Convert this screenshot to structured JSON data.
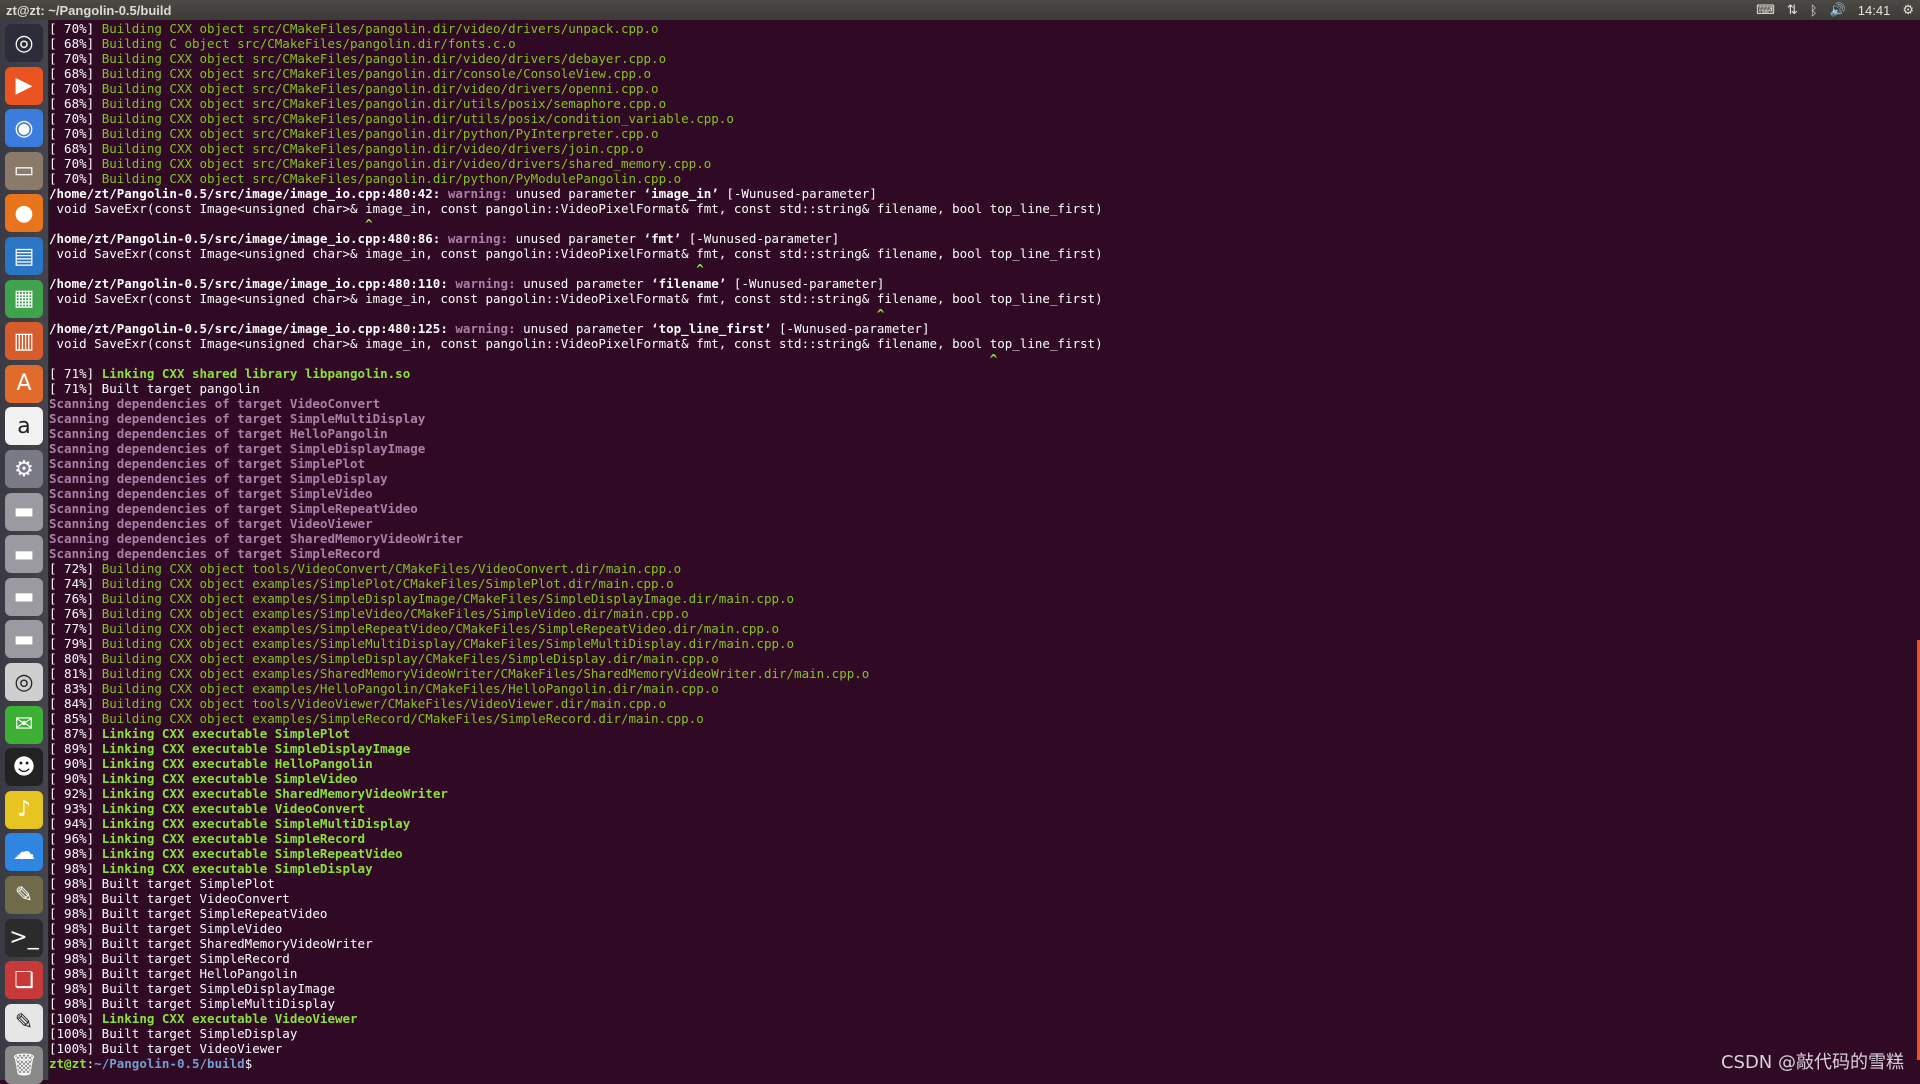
{
  "window": {
    "title": "zt@zt: ~/Pangolin-0.5/build"
  },
  "tray": {
    "time": "14:41"
  },
  "watermark": "CSDN @敲代码的雪糕",
  "launcher_colors": {
    "accent": "#e95420"
  },
  "build_lines_1": [
    [
      "[ 70%] ",
      "Building CXX object src/CMakeFiles/pangolin.dir/video/drivers/unpack.cpp.o"
    ],
    [
      "[ 68%] ",
      "Building C object src/CMakeFiles/pangolin.dir/fonts.c.o"
    ],
    [
      "[ 70%] ",
      "Building CXX object src/CMakeFiles/pangolin.dir/video/drivers/debayer.cpp.o"
    ],
    [
      "[ 68%] ",
      "Building CXX object src/CMakeFiles/pangolin.dir/console/ConsoleView.cpp.o"
    ],
    [
      "[ 70%] ",
      "Building CXX object src/CMakeFiles/pangolin.dir/video/drivers/openni.cpp.o"
    ],
    [
      "[ 68%] ",
      "Building CXX object src/CMakeFiles/pangolin.dir/utils/posix/semaphore.cpp.o"
    ],
    [
      "[ 70%] ",
      "Building CXX object src/CMakeFiles/pangolin.dir/utils/posix/condition_variable.cpp.o"
    ],
    [
      "[ 70%] ",
      "Building CXX object src/CMakeFiles/pangolin.dir/python/PyInterpreter.cpp.o"
    ],
    [
      "[ 68%] ",
      "Building CXX object src/CMakeFiles/pangolin.dir/video/drivers/join.cpp.o"
    ],
    [
      "[ 70%] ",
      "Building CXX object src/CMakeFiles/pangolin.dir/video/drivers/shared_memory.cpp.o"
    ],
    [
      "[ 70%] ",
      "Building CXX object src/CMakeFiles/pangolin.dir/python/PyModulePangolin.cpp.o"
    ]
  ],
  "warnings": [
    {
      "loc": "/home/zt/Pangolin-0.5/src/image/image_io.cpp:480:42:",
      "label": "warning:",
      "msg_pre": " unused parameter ",
      "param": "‘image_in’",
      "flag": " [-Wunused-parameter]",
      "code": " void SaveExr(const Image<unsigned char>& image_in, const pangolin::VideoPixelFormat& fmt, const std::string& filename, bool top_line_first)",
      "caret": "                                          ^"
    },
    {
      "loc": "/home/zt/Pangolin-0.5/src/image/image_io.cpp:480:86:",
      "label": "warning:",
      "msg_pre": " unused parameter ",
      "param": "‘fmt’",
      "flag": " [-Wunused-parameter]",
      "code": " void SaveExr(const Image<unsigned char>& image_in, const pangolin::VideoPixelFormat& fmt, const std::string& filename, bool top_line_first)",
      "caret": "                                                                                      ^"
    },
    {
      "loc": "/home/zt/Pangolin-0.5/src/image/image_io.cpp:480:110:",
      "label": "warning:",
      "msg_pre": " unused parameter ",
      "param": "‘filename’",
      "flag": " [-Wunused-parameter]",
      "code": " void SaveExr(const Image<unsigned char>& image_in, const pangolin::VideoPixelFormat& fmt, const std::string& filename, bool top_line_first)",
      "caret": "                                                                                                              ^"
    },
    {
      "loc": "/home/zt/Pangolin-0.5/src/image/image_io.cpp:480:125:",
      "label": "warning:",
      "msg_pre": " unused parameter ",
      "param": "‘top_line_first’",
      "flag": " [-Wunused-parameter]",
      "code": " void SaveExr(const Image<unsigned char>& image_in, const pangolin::VideoPixelFormat& fmt, const std::string& filename, bool top_line_first)",
      "caret": "                                                                                                                             ^"
    }
  ],
  "link_lib": [
    "[ 71%] ",
    "Linking CXX shared library libpangolin.so"
  ],
  "built_pangolin": "[ 71%] Built target pangolin",
  "scanning": [
    "Scanning dependencies of target VideoConvert",
    "Scanning dependencies of target SimpleMultiDisplay",
    "Scanning dependencies of target HelloPangolin",
    "Scanning dependencies of target SimpleDisplayImage",
    "Scanning dependencies of target SimplePlot",
    "Scanning dependencies of target SimpleDisplay",
    "Scanning dependencies of target SimpleVideo",
    "Scanning dependencies of target SimpleRepeatVideo",
    "Scanning dependencies of target VideoViewer",
    "Scanning dependencies of target SharedMemoryVideoWriter",
    "Scanning dependencies of target SimpleRecord"
  ],
  "build_lines_2": [
    [
      "[ 72%] ",
      "Building CXX object tools/VideoConvert/CMakeFiles/VideoConvert.dir/main.cpp.o"
    ],
    [
      "[ 74%] ",
      "Building CXX object examples/SimplePlot/CMakeFiles/SimplePlot.dir/main.cpp.o"
    ],
    [
      "[ 76%] ",
      "Building CXX object examples/SimpleDisplayImage/CMakeFiles/SimpleDisplayImage.dir/main.cpp.o"
    ],
    [
      "[ 76%] ",
      "Building CXX object examples/SimpleVideo/CMakeFiles/SimpleVideo.dir/main.cpp.o"
    ],
    [
      "[ 77%] ",
      "Building CXX object examples/SimpleRepeatVideo/CMakeFiles/SimpleRepeatVideo.dir/main.cpp.o"
    ],
    [
      "[ 79%] ",
      "Building CXX object examples/SimpleMultiDisplay/CMakeFiles/SimpleMultiDisplay.dir/main.cpp.o"
    ],
    [
      "[ 80%] ",
      "Building CXX object examples/SimpleDisplay/CMakeFiles/SimpleDisplay.dir/main.cpp.o"
    ],
    [
      "[ 81%] ",
      "Building CXX object examples/SharedMemoryVideoWriter/CMakeFiles/SharedMemoryVideoWriter.dir/main.cpp.o"
    ],
    [
      "[ 83%] ",
      "Building CXX object examples/HelloPangolin/CMakeFiles/HelloPangolin.dir/main.cpp.o"
    ],
    [
      "[ 84%] ",
      "Building CXX object tools/VideoViewer/CMakeFiles/VideoViewer.dir/main.cpp.o"
    ],
    [
      "[ 85%] ",
      "Building CXX object examples/SimpleRecord/CMakeFiles/SimpleRecord.dir/main.cpp.o"
    ]
  ],
  "link_exe": [
    [
      "[ 87%] ",
      "Linking CXX executable SimplePlot"
    ],
    [
      "[ 89%] ",
      "Linking CXX executable SimpleDisplayImage"
    ],
    [
      "[ 90%] ",
      "Linking CXX executable HelloPangolin"
    ],
    [
      "[ 90%] ",
      "Linking CXX executable SimpleVideo"
    ],
    [
      "[ 92%] ",
      "Linking CXX executable SharedMemoryVideoWriter"
    ],
    [
      "[ 93%] ",
      "Linking CXX executable VideoConvert"
    ],
    [
      "[ 94%] ",
      "Linking CXX executable SimpleMultiDisplay"
    ],
    [
      "[ 96%] ",
      "Linking CXX executable SimpleRecord"
    ],
    [
      "[ 98%] ",
      "Linking CXX executable SimpleRepeatVideo"
    ],
    [
      "[ 98%] ",
      "Linking CXX executable SimpleDisplay"
    ]
  ],
  "built_targets": [
    "[ 98%] Built target SimplePlot",
    "[ 98%] Built target VideoConvert",
    "[ 98%] Built target SimpleRepeatVideo",
    "[ 98%] Built target SimpleVideo",
    "[ 98%] Built target SharedMemoryVideoWriter",
    "[ 98%] Built target SimpleRecord",
    "[ 98%] Built target HelloPangolin",
    "[ 98%] Built target SimpleDisplayImage",
    "[ 98%] Built target SimpleMultiDisplay"
  ],
  "link_viewer": [
    "[100%] ",
    "Linking CXX executable VideoViewer"
  ],
  "final_built": [
    "[100%] Built target SimpleDisplay",
    "[100%] Built target VideoViewer"
  ],
  "prompt": {
    "user": "zt@zt",
    "sep": ":",
    "path": "~/Pangolin-0.5/build",
    "symbol": "$"
  },
  "launcher": [
    "ubuntu-dash-icon",
    "video-player-icon",
    "chrome-icon",
    "files-icon",
    "firefox-icon",
    "writer-icon",
    "calc-icon",
    "impress-icon",
    "software-center-icon",
    "amazon-icon",
    "settings-icon",
    "drive-icon",
    "drive-icon",
    "drive-icon",
    "drive-icon",
    "dvd-icon",
    "wechat-icon",
    "qq-icon",
    "music-icon",
    "baidu-netdisk-icon",
    "gimp-icon",
    "terminal-icon",
    "pdf-viewer-icon",
    "text-editor-icon",
    "trash-icon"
  ]
}
